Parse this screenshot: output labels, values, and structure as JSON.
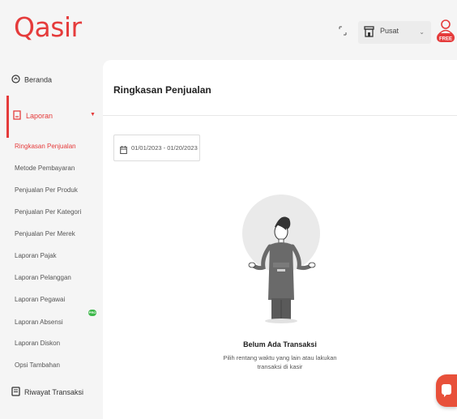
{
  "app": {
    "logo_text": "Qasir"
  },
  "header": {
    "expand_icon": "expand-arrows-icon",
    "outlet_label": "Pusat",
    "outlet_icon": "store-icon",
    "avatar_badge": "FREE",
    "accent_color": "#e53b3b"
  },
  "sidebar": {
    "beranda": {
      "label": "Beranda",
      "icon": "dashboard-icon"
    },
    "laporan": {
      "label": "Laporan",
      "icon": "report-icon",
      "items": [
        {
          "label": "Ringkasan Penjualan",
          "active": true
        },
        {
          "label": "Metode Pembayaran"
        },
        {
          "label": "Penjualan Per Produk"
        },
        {
          "label": "Penjualan Per Kategori"
        },
        {
          "label": "Penjualan Per Merek"
        },
        {
          "label": "Laporan Pajak"
        },
        {
          "label": "Laporan Pelanggan"
        },
        {
          "label": "Laporan Pegawai"
        },
        {
          "label": "Laporan Absensi",
          "badge": "PRO"
        },
        {
          "label": "Laporan Diskon"
        },
        {
          "label": "Opsi Tambahan"
        }
      ]
    },
    "riwayat": {
      "label": "Riwayat Transaksi",
      "icon": "receipt-icon"
    }
  },
  "main": {
    "title": "Ringkasan Penjualan",
    "date_range": "01/01/2023 - 01/20/2023",
    "empty_state": {
      "title": "Belum Ada Transaksi",
      "desc_line1": "Pilih rentang waktu yang lain atau lakukan",
      "desc_line2": "transaksi di kasir"
    }
  },
  "chat": {
    "icon": "chat-icon"
  }
}
